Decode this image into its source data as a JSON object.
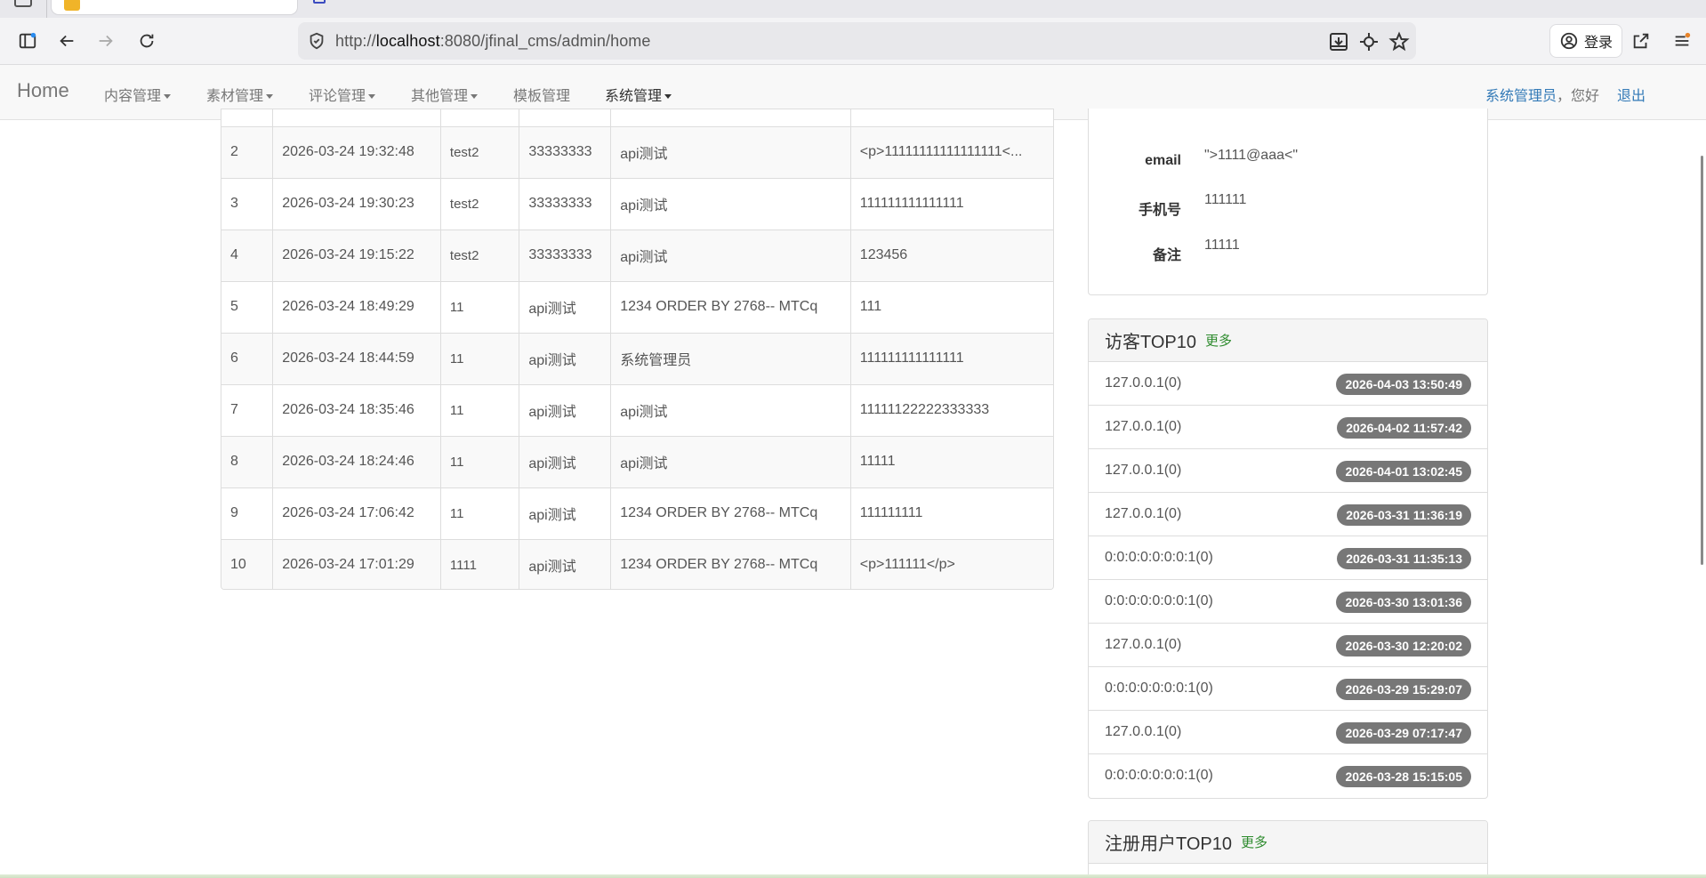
{
  "browser": {
    "url_prefix": "http://",
    "url_host": "localhost",
    "url_rest": ":8080/jfinal_cms/admin/home",
    "login_label": "登录"
  },
  "navbar": {
    "brand": "Home",
    "items": [
      {
        "label": "内容管理",
        "dropdown": true
      },
      {
        "label": "素材管理",
        "dropdown": true
      },
      {
        "label": "评论管理",
        "dropdown": true
      },
      {
        "label": "其他管理",
        "dropdown": true
      },
      {
        "label": "模板管理",
        "dropdown": false
      },
      {
        "label": "系统管理",
        "dropdown": true
      }
    ],
    "user_name": "系统管理员",
    "user_hello": "，您好",
    "logout": "退出"
  },
  "comments_table": {
    "rows": [
      {
        "no": "2",
        "time": "2026-03-24 19:32:48",
        "user": "test2",
        "target": "33333333",
        "title": "api测试",
        "content": "<p>11111111111111111<..."
      },
      {
        "no": "3",
        "time": "2026-03-24 19:30:23",
        "user": "test2",
        "target": "33333333",
        "title": "api测试",
        "content": "111111111111111"
      },
      {
        "no": "4",
        "time": "2026-03-24 19:15:22",
        "user": "test2",
        "target": "33333333",
        "title": "api测试",
        "content": "123456"
      },
      {
        "no": "5",
        "time": "2026-03-24 18:49:29",
        "user": "11",
        "target": "api测试",
        "title": "1234 ORDER BY 2768-- MTCq",
        "content": "111"
      },
      {
        "no": "6",
        "time": "2026-03-24 18:44:59",
        "user": "11",
        "target": "api测试",
        "title": "系统管理员",
        "content": "111111111111111"
      },
      {
        "no": "7",
        "time": "2026-03-24 18:35:46",
        "user": "11",
        "target": "api测试",
        "title": "api测试",
        "content": "11111122222333333"
      },
      {
        "no": "8",
        "time": "2026-03-24 18:24:46",
        "user": "11",
        "target": "api测试",
        "title": "api测试",
        "content": "11111"
      },
      {
        "no": "9",
        "time": "2026-03-24 17:06:42",
        "user": "11",
        "target": "api测试",
        "title": "1234 ORDER BY 2768-- MTCq",
        "content": "111111111"
      },
      {
        "no": "10",
        "time": "2026-03-24 17:01:29",
        "user": "1111",
        "target": "api测试",
        "title": "1234 ORDER BY 2768-- MTCq",
        "content": "<p>111111</p>"
      }
    ]
  },
  "profile": {
    "email_label": "email",
    "email_value": "\">1111@aaa<\"",
    "phone_label": "手机号",
    "phone_value": "111111",
    "remark_label": "备注",
    "remark_value": "11111"
  },
  "visitors": {
    "title": "访客TOP10",
    "more": "更多",
    "items": [
      {
        "ip": "127.0.0.1(0)",
        "time": "2026-04-03 13:50:49"
      },
      {
        "ip": "127.0.0.1(0)",
        "time": "2026-04-02 11:57:42"
      },
      {
        "ip": "127.0.0.1(0)",
        "time": "2026-04-01 13:02:45"
      },
      {
        "ip": "127.0.0.1(0)",
        "time": "2026-03-31 11:36:19"
      },
      {
        "ip": "0:0:0:0:0:0:0:1(0)",
        "time": "2026-03-31 11:35:13"
      },
      {
        "ip": "0:0:0:0:0:0:0:1(0)",
        "time": "2026-03-30 13:01:36"
      },
      {
        "ip": "127.0.0.1(0)",
        "time": "2026-03-30 12:20:02"
      },
      {
        "ip": "0:0:0:0:0:0:0:1(0)",
        "time": "2026-03-29 15:29:07"
      },
      {
        "ip": "127.0.0.1(0)",
        "time": "2026-03-29 07:17:47"
      },
      {
        "ip": "0:0:0:0:0:0:0:1(0)",
        "time": "2026-03-28 15:15:05"
      }
    ]
  },
  "users_panel": {
    "title": "注册用户TOP10",
    "more": "更多"
  },
  "colors": {
    "link": "#337ab7",
    "more_green": "#2e8b2e",
    "badge_gray": "#777777"
  }
}
